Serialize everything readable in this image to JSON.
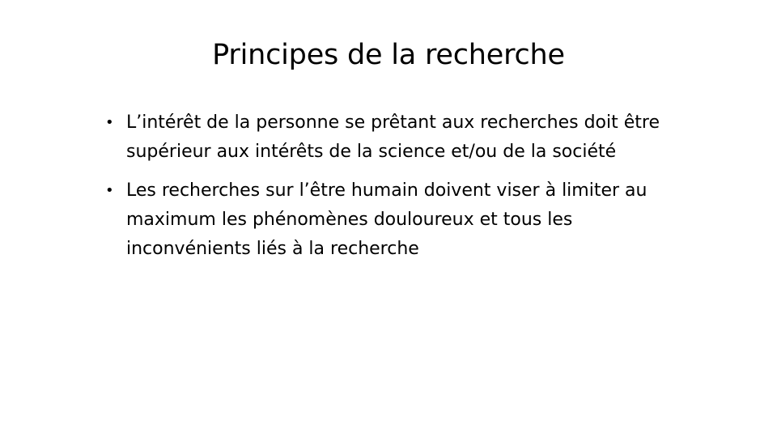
{
  "slide": {
    "title": "Principes de la recherche",
    "bullet_glyph": "•",
    "bullets": [
      "L’intérêt de la personne se prêtant aux recherches doit être supérieur aux intérêts de la science et/ou de la société",
      "Les recherches sur l’être humain doivent viser à limiter au maximum les phénomènes douloureux et tous les inconvénients liés à la recherche"
    ]
  }
}
